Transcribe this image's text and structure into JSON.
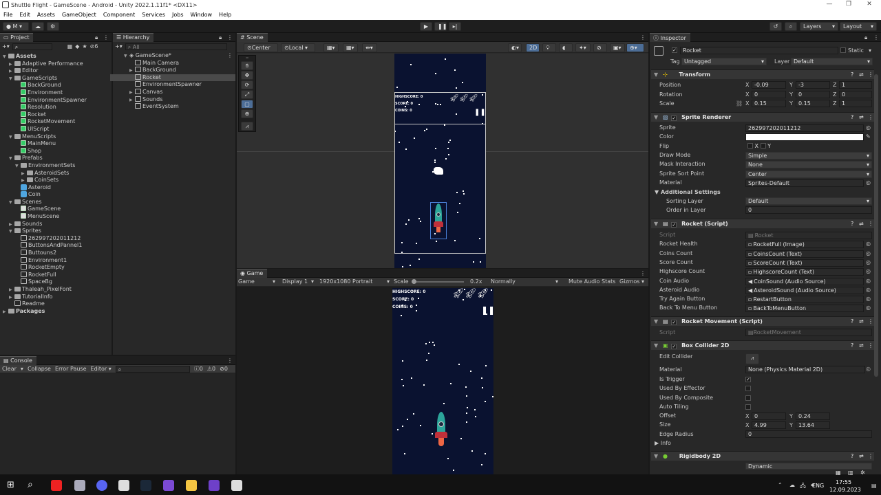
{
  "window": {
    "title": "Shuttle Flight - GameScene - Android - Unity 2022.1.11f1* <DX11>"
  },
  "menu": [
    "File",
    "Edit",
    "Assets",
    "GameObject",
    "Component",
    "Services",
    "Jobs",
    "Window",
    "Help"
  ],
  "toolbar": {
    "account": "M",
    "layers": "Layers",
    "layout": "Layout"
  },
  "project": {
    "tab": "Project",
    "count": "6",
    "search_placeholder": "",
    "tree": [
      {
        "label": "Assets",
        "depth": 0,
        "type": "folder",
        "open": true,
        "bold": true
      },
      {
        "label": "Adaptive Performance",
        "depth": 1,
        "type": "folder"
      },
      {
        "label": "Editor",
        "depth": 1,
        "type": "folder"
      },
      {
        "label": "GameScripts",
        "depth": 1,
        "type": "folder",
        "open": true
      },
      {
        "label": "BackGround",
        "depth": 2,
        "type": "script"
      },
      {
        "label": "Environment",
        "depth": 2,
        "type": "script"
      },
      {
        "label": "EnvironmentSpawner",
        "depth": 2,
        "type": "script"
      },
      {
        "label": "Resolution",
        "depth": 2,
        "type": "script"
      },
      {
        "label": "Rocket",
        "depth": 2,
        "type": "script"
      },
      {
        "label": "RocketMovement",
        "depth": 2,
        "type": "script"
      },
      {
        "label": "UIScript",
        "depth": 2,
        "type": "script"
      },
      {
        "label": "MenuScripts",
        "depth": 1,
        "type": "folder",
        "open": true
      },
      {
        "label": "MainMenu",
        "depth": 2,
        "type": "script"
      },
      {
        "label": "Shop",
        "depth": 2,
        "type": "script"
      },
      {
        "label": "Prefabs",
        "depth": 1,
        "type": "folder",
        "open": true
      },
      {
        "label": "EnvironmentSets",
        "depth": 2,
        "type": "folder",
        "open": true
      },
      {
        "label": "AsteroidSets",
        "depth": 3,
        "type": "folder"
      },
      {
        "label": "CoinSets",
        "depth": 3,
        "type": "folder"
      },
      {
        "label": "Asteroid",
        "depth": 2,
        "type": "prefab"
      },
      {
        "label": "Coin",
        "depth": 2,
        "type": "prefab"
      },
      {
        "label": "Scenes",
        "depth": 1,
        "type": "folder",
        "open": true
      },
      {
        "label": "GameScene",
        "depth": 2,
        "type": "scene"
      },
      {
        "label": "MenuScene",
        "depth": 2,
        "type": "scene"
      },
      {
        "label": "Sounds",
        "depth": 1,
        "type": "folder"
      },
      {
        "label": "Sprites",
        "depth": 1,
        "type": "folder",
        "open": true
      },
      {
        "label": "262997202011212",
        "depth": 2,
        "type": "sprite"
      },
      {
        "label": "ButtonsAndPannel1",
        "depth": 2,
        "type": "sprite"
      },
      {
        "label": "Buttouns2",
        "depth": 2,
        "type": "sprite"
      },
      {
        "label": "Environment1",
        "depth": 2,
        "type": "sprite"
      },
      {
        "label": "RocketEmpty",
        "depth": 2,
        "type": "sprite"
      },
      {
        "label": "RocketFull",
        "depth": 2,
        "type": "sprite"
      },
      {
        "label": "SpaceBg",
        "depth": 2,
        "type": "sprite"
      },
      {
        "label": "Thaleah_PixelFont",
        "depth": 1,
        "type": "folder"
      },
      {
        "label": "TutorialInfo",
        "depth": 1,
        "type": "folder"
      },
      {
        "label": "Readme",
        "depth": 1,
        "type": "asset"
      },
      {
        "label": "Packages",
        "depth": 0,
        "type": "folder",
        "bold": true
      }
    ]
  },
  "console": {
    "tab": "Console",
    "clear": "Clear",
    "collapse": "Collapse",
    "error_pause": "Error Pause",
    "editor": "Editor",
    "count_info": "0",
    "count_warn": "0",
    "count_err": "0"
  },
  "hierarchy": {
    "tab": "Hierarchy",
    "search_placeholder": "All",
    "scene": "GameScene*",
    "items": [
      {
        "label": "Main Camera",
        "arrow": false
      },
      {
        "label": "BackGround",
        "arrow": true
      },
      {
        "label": "Rocket",
        "arrow": false,
        "selected": true
      },
      {
        "label": "EnvironmentSpawner",
        "arrow": false
      },
      {
        "label": "Canvas",
        "arrow": true
      },
      {
        "label": "Sounds",
        "arrow": true
      },
      {
        "label": "EventSystem",
        "arrow": false
      }
    ]
  },
  "scene": {
    "tab": "Scene",
    "pivot": "Center",
    "space": "Local",
    "mode2d": "2D",
    "hud": {
      "highscore": "HIGHSCORE: 0",
      "score": "SCORE: 0",
      "coins": "COINS: 0"
    }
  },
  "game": {
    "tab": "Game",
    "view": "Game",
    "display": "Display 1",
    "resolution": "1920x1080 Portrait",
    "scale_label": "Scale",
    "scale_value": "0.2x",
    "play_mode": "Normally",
    "mute": "Mute Audio",
    "stats": "Stats",
    "gizmos": "Gizmos",
    "hud": {
      "highscore": "HIGHSCORE: 0",
      "score": "SCORE: 0",
      "coins": "COINS: 0"
    }
  },
  "inspector": {
    "tab": "Inspector",
    "object": "Rocket",
    "static": "Static",
    "tag_label": "Tag",
    "tag": "Untagged",
    "layer_label": "Layer",
    "layer": "Default",
    "transform": {
      "title": "Transform",
      "position_label": "Position",
      "rotation_label": "Rotation",
      "scale_label": "Scale",
      "position": [
        "-0.09",
        "-3",
        "1"
      ],
      "rotation": [
        "0",
        "0",
        "0"
      ],
      "scale": [
        "0.15",
        "0.15",
        "1"
      ]
    },
    "sprite_renderer": {
      "title": "Sprite Renderer",
      "rows": [
        {
          "label": "Sprite",
          "value": "262997202011212"
        },
        {
          "label": "Color",
          "value": ""
        },
        {
          "label": "Flip",
          "value": "X   Y"
        },
        {
          "label": "Draw Mode",
          "value": "Simple"
        },
        {
          "label": "Mask Interaction",
          "value": "None"
        },
        {
          "label": "Sprite Sort Point",
          "value": "Center"
        },
        {
          "label": "Material",
          "value": "Sprites-Default"
        }
      ],
      "additional": "Additional Settings",
      "sorting_layer_label": "Sorting Layer",
      "sorting_layer": "Default",
      "order_label": "Order in Layer",
      "order": "0"
    },
    "rocket_script": {
      "title": "Rocket (Script)",
      "rows": [
        {
          "label": "Script",
          "value": "Rocket"
        },
        {
          "label": "Rocket Health",
          "value": "RocketFull (Image)"
        },
        {
          "label": "Coins Count",
          "value": "CoinsCount (Text)"
        },
        {
          "label": "Score Count",
          "value": "ScoreCount (Text)"
        },
        {
          "label": "Highscore Count",
          "value": "HighscoreCount (Text)"
        },
        {
          "label": "Coin Audio",
          "value": "CoinSound (Audio Source)"
        },
        {
          "label": "Asteroid Audio",
          "value": "AsteroidSound (Audio Source)"
        },
        {
          "label": "Try Again Button",
          "value": "RestartButton"
        },
        {
          "label": "Back To Menu Button",
          "value": "BackToMenuButton"
        }
      ]
    },
    "rocket_movement": {
      "title": "Rocket Movement (Script)",
      "script_label": "Script",
      "script": "RocketMovement"
    },
    "box_collider": {
      "title": "Box Collider 2D",
      "edit": "Edit Collider",
      "material_label": "Material",
      "material": "None (Physics Material 2D)",
      "is_trigger": "Is Trigger",
      "used_by_effector": "Used By Effector",
      "used_by_composite": "Used By Composite",
      "auto_tiling": "Auto Tiling",
      "offset_label": "Offset",
      "offset": [
        "0",
        "0.24"
      ],
      "size_label": "Size",
      "size": [
        "4.99",
        "13.64"
      ],
      "edge_label": "Edge Radius",
      "edge": "0",
      "info": "Info"
    },
    "rigidbody": {
      "title": "Rigidbody 2D",
      "body_type": "Dynamic"
    }
  },
  "taskbar": {
    "lang": "ENG",
    "time": "17:55",
    "date": "12.09.2023"
  }
}
